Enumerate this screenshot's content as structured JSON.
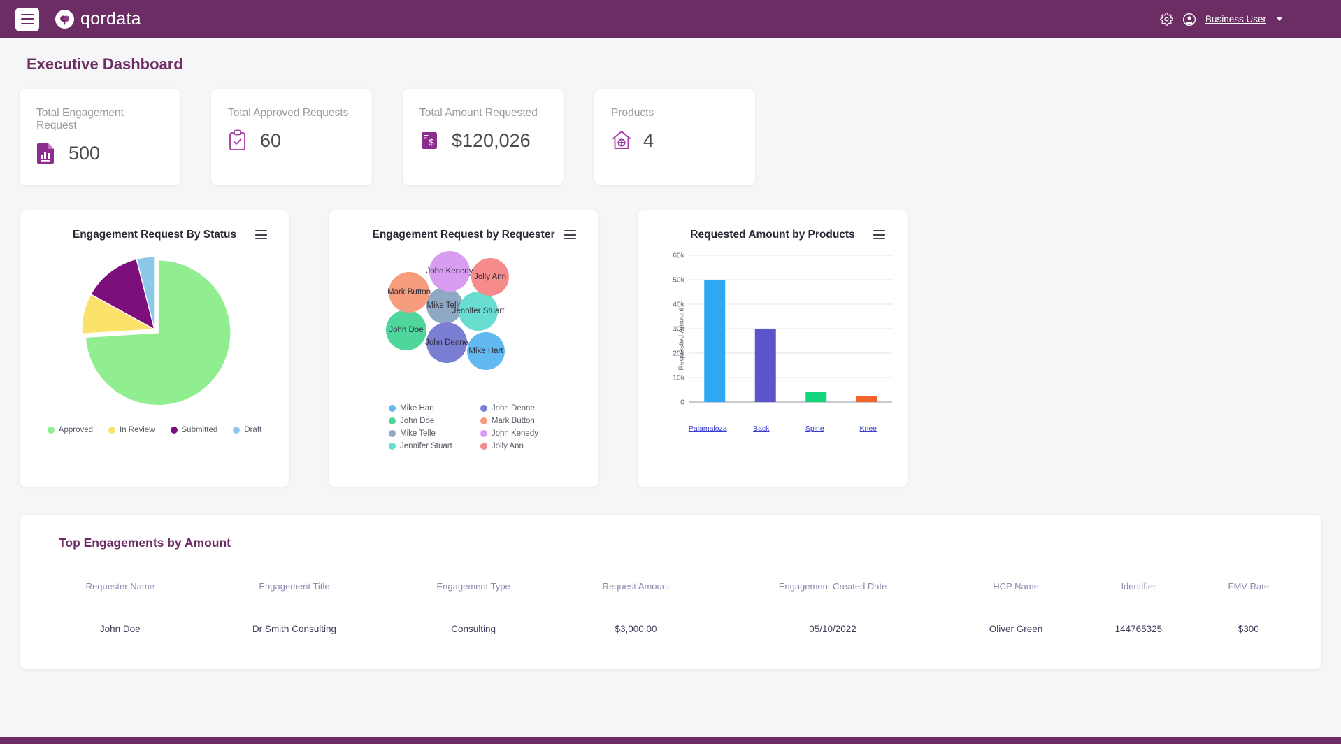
{
  "topbar": {
    "menu_icon": "hamburger-icon",
    "brand_name": "qordata",
    "settings_icon": "gear-icon",
    "avatar_icon": "user-circle-icon",
    "user_label": "Business User",
    "caret_icon": "chevron-down-icon",
    "bg_color": "#6b2d63"
  },
  "page": {
    "title": "Executive Dashboard",
    "accent_color": "#6b2d63"
  },
  "kpis": [
    {
      "label": "Total Engagement Request",
      "value": "500",
      "icon": "document-chart-icon"
    },
    {
      "label": "Total Approved Requests",
      "value": "60",
      "icon": "clipboard-check-icon"
    },
    {
      "label": "Total Amount Requested",
      "value": "$120,026",
      "icon": "money-bill-icon"
    },
    {
      "label": "Products",
      "value": "4",
      "icon": "house-plus-icon"
    }
  ],
  "charts": {
    "pie": {
      "title": "Engagement Request By Status",
      "menu_icon": "hamburger-menu-icon"
    },
    "bubble": {
      "title": "Engagement Request by Requester",
      "menu_icon": "hamburger-menu-icon"
    },
    "bar": {
      "title": "Requested Amount by Products",
      "menu_icon": "hamburger-menu-icon"
    }
  },
  "chart_data": [
    {
      "type": "pie",
      "title": "Engagement Request By Status",
      "categories": [
        "Approved",
        "In Review",
        "Submitted",
        "Draft"
      ],
      "values": [
        74,
        9,
        13,
        4
      ],
      "colors": [
        "#90ee90",
        "#fbe36b",
        "#7d0f7d",
        "#8cc8e8"
      ],
      "legend_position": "bottom",
      "exploded_slice": "Approved"
    },
    {
      "type": "scatter",
      "title": "Engagement Request by Requester",
      "series": [
        {
          "name": "Mike Hart",
          "color": "#62b9f0",
          "size": 46
        },
        {
          "name": "John Doe",
          "color": "#4fd69c",
          "size": 54
        },
        {
          "name": "Mike Telle",
          "color": "#8fa8c4",
          "size": 48
        },
        {
          "name": "Jennifer Stuart",
          "color": "#67ded0",
          "size": 50
        },
        {
          "name": "John Denne",
          "color": "#7b7fd4",
          "size": 52
        },
        {
          "name": "Mark Button",
          "color": "#f79c7c",
          "size": 52
        },
        {
          "name": "John Kenedy",
          "color": "#d89cf0",
          "size": 52
        },
        {
          "name": "Jolly Ann",
          "color": "#f58b8b",
          "size": 48
        }
      ],
      "legend_position": "bottom"
    },
    {
      "type": "bar",
      "title": "Requested Amount by Products",
      "categories": [
        "Palamaloza",
        "Back",
        "Spine",
        "Knee"
      ],
      "values": [
        50000,
        30000,
        4000,
        2500
      ],
      "colors": [
        "#2fa7f5",
        "#5b55c9",
        "#14d67e",
        "#f4622e"
      ],
      "xlabel": "",
      "ylabel": "Requested Amount",
      "ylim": [
        0,
        60000
      ],
      "yticks": [
        "0",
        "10k",
        "20k",
        "30k",
        "40k",
        "50k",
        "60k"
      ],
      "grid": true
    }
  ],
  "table": {
    "title": "Top Engagements by Amount",
    "columns": [
      "Requester Name",
      "Engagement Title",
      "Engagement Type",
      "Request Amount",
      "Engagement Created Date",
      "HCP Name",
      "Identifier",
      "FMV Rate"
    ],
    "rows": [
      [
        "John Doe",
        "Dr Smith Consulting",
        "Consulting",
        "$3,000.00",
        "05/10/2022",
        "Oliver Green",
        "144765325",
        "$300"
      ]
    ]
  }
}
